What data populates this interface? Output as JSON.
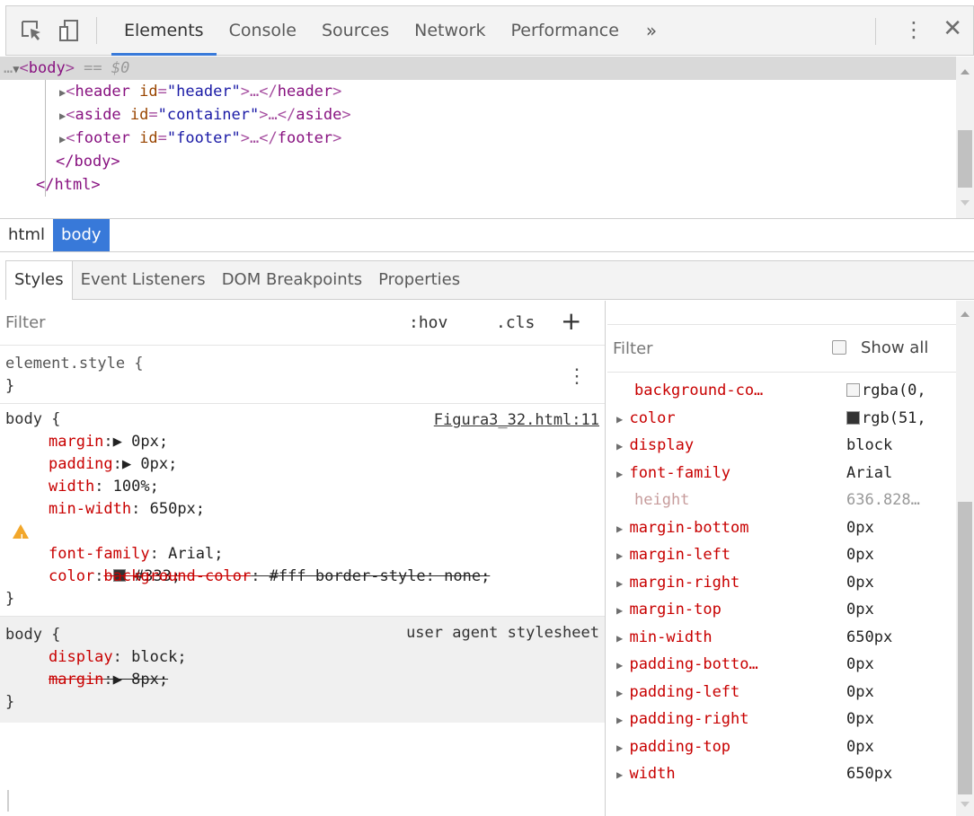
{
  "toolbar": {
    "tabs": [
      "Elements",
      "Console",
      "Sources",
      "Network",
      "Performance"
    ],
    "more": "»",
    "kebab": "⋮",
    "close": "✕"
  },
  "dom": {
    "lines": [
      {
        "prefix": "…▼",
        "open": "<",
        "tag": "body",
        "close": ">",
        "suffix": " == $0"
      },
      {
        "tag": "header",
        "attr": "id",
        "val": "\"header\"",
        "ellipsis": ">…</",
        "endtag": "header"
      },
      {
        "tag": "aside",
        "attr": "id",
        "val": "\"container\"",
        "ellipsis": ">…</",
        "endtag": "aside"
      },
      {
        "tag": "footer",
        "attr": "id",
        "val": "\"footer\"",
        "ellipsis": ">…</",
        "endtag": "footer"
      },
      {
        "text": "</body>"
      },
      {
        "text": "</html>"
      }
    ]
  },
  "breadcrumbs": [
    "html",
    "body"
  ],
  "subtabs": [
    "Styles",
    "Event Listeners",
    "DOM Breakpoints",
    "Properties"
  ],
  "styles": {
    "filter_placeholder": "Filter",
    "hov": ":hov",
    "cls": ".cls",
    "plus": "+",
    "element_style": {
      "selector": "element.style {",
      "close": "}"
    },
    "rule1": {
      "selector": "body {",
      "source": "Figura3_32.html:11",
      "props": [
        {
          "name": "margin",
          "sep": ":",
          "val": "▶ 0px;"
        },
        {
          "name": "padding",
          "sep": ":",
          "val": "▶ 0px;"
        },
        {
          "name": "width",
          "sep": ": ",
          "val": "100%;"
        },
        {
          "name": "min-width",
          "sep": ": ",
          "val": "650px;"
        },
        {
          "name": "background-color",
          "sep": ": ",
          "val": "#fff border-style: none;"
        },
        {
          "name": "font-family",
          "sep": ": ",
          "val": "Arial;"
        },
        {
          "name": "color",
          "sep": ": ",
          "val": "#333;"
        }
      ],
      "close": "}"
    },
    "rule2": {
      "selector": "body {",
      "source": "user agent stylesheet",
      "props": [
        {
          "name": "display",
          "sep": ": ",
          "val": "block;"
        },
        {
          "name": "margin",
          "sep": ":",
          "val": "▶ 8px;"
        }
      ],
      "close": "}"
    }
  },
  "computed": {
    "filter_placeholder": "Filter",
    "show_all": "Show all",
    "rows": [
      {
        "name": "background-co…",
        "value": "rgba(0,",
        "swatch": "#ffffff"
      },
      {
        "name": "color",
        "value": "rgb(51,",
        "swatch": "#333333"
      },
      {
        "name": "display",
        "value": "block"
      },
      {
        "name": "font-family",
        "value": "Arial"
      },
      {
        "name": "height",
        "value": "636.828…"
      },
      {
        "name": "margin-bottom",
        "value": "0px"
      },
      {
        "name": "margin-left",
        "value": "0px"
      },
      {
        "name": "margin-right",
        "value": "0px"
      },
      {
        "name": "margin-top",
        "value": "0px"
      },
      {
        "name": "min-width",
        "value": "650px"
      },
      {
        "name": "padding-botto…",
        "value": "0px"
      },
      {
        "name": "padding-left",
        "value": "0px"
      },
      {
        "name": "padding-right",
        "value": "0px"
      },
      {
        "name": "padding-top",
        "value": "0px"
      },
      {
        "name": "width",
        "value": "650px"
      }
    ]
  },
  "colors": {
    "accent": "#3879d9",
    "prop_name": "#c80000",
    "tag": "#881280",
    "attr_name": "#994500",
    "attr_value": "#1a1aa6"
  }
}
